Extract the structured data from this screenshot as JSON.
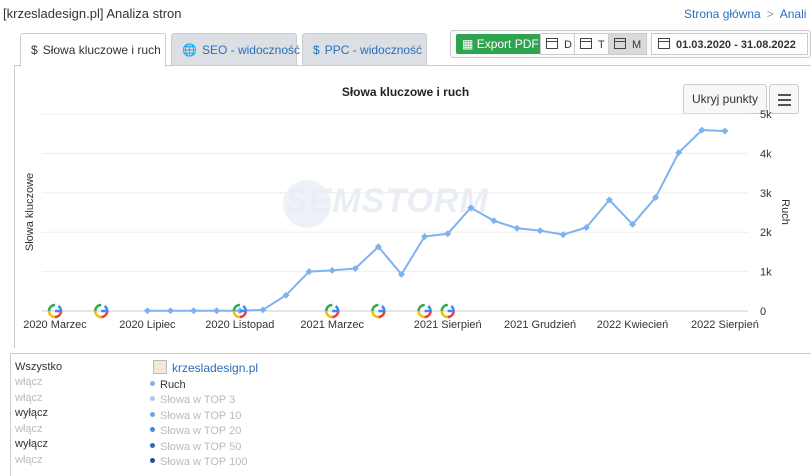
{
  "header": {
    "title": "[krzesladesign.pl] Analiza stron",
    "breadcrumb": [
      "Strona główna",
      "Anali"
    ]
  },
  "tabs": [
    {
      "label": "Słowa kluczowe i ruch",
      "icon": "dollar-icon",
      "active": true
    },
    {
      "label": "SEO - widoczność",
      "icon": "globe-icon",
      "active": false
    },
    {
      "label": "PPC - widoczność",
      "icon": "dollar-icon",
      "active": false
    }
  ],
  "toolbar": {
    "export_label": "Export PDF",
    "period_day": "D",
    "period_week": "T",
    "period_month": "M",
    "selected_period": "M",
    "date_range": "01.03.2020 - 31.08.2022"
  },
  "chart": {
    "title": "Słowa kluczowe i ruch",
    "hide_points_label": "Ukryj punkty",
    "ylabel_left": "Słowa kluczowe",
    "ylabel_right": "Ruch",
    "watermark": "SEMSTORM",
    "accent_color": "#7fb2f0"
  },
  "chart_data": {
    "type": "line",
    "x_labels": [
      "2020 Marzec",
      "2020 Lipiec",
      "2020 Listopad",
      "2021 Marzec",
      "2021 Sierpień",
      "2021 Grudzień",
      "2022 Kwiecień",
      "2022 Sierpień"
    ],
    "y_right_ticks": [
      "0",
      "1k",
      "2k",
      "3k",
      "4k",
      "5k"
    ],
    "ylim": [
      0,
      5000
    ],
    "series": [
      {
        "name": "Ruch",
        "x": [
          "2020-03",
          "2020-04",
          "2020-05",
          "2020-06",
          "2020-07",
          "2020-08",
          "2020-09",
          "2020-10",
          "2020-11",
          "2020-12",
          "2021-01",
          "2021-02",
          "2021-03",
          "2021-04",
          "2021-05",
          "2021-06",
          "2021-07",
          "2021-08",
          "2021-09",
          "2021-10",
          "2021-11",
          "2021-12",
          "2022-01",
          "2022-02",
          "2022-03",
          "2022-04",
          "2022-05",
          "2022-06",
          "2022-07",
          "2022-08"
        ],
        "values": [
          null,
          null,
          null,
          null,
          5,
          5,
          5,
          5,
          5,
          30,
          400,
          1000,
          1030,
          1080,
          1630,
          930,
          1890,
          1960,
          2620,
          2290,
          2100,
          2040,
          1940,
          2120,
          2820,
          2200,
          2880,
          4020,
          4590,
          4570
        ]
      }
    ],
    "google_update_markers": [
      "2020-03",
      "2020-05",
      "2020-11",
      "2021-03",
      "2021-05",
      "2021-07",
      "2021-08"
    ],
    "grid": true
  },
  "legend": {
    "all_label": "Wszystko",
    "toggles": [
      "włącz",
      "włącz",
      "wyłącz",
      "włącz",
      "wyłącz",
      "włącz"
    ],
    "site": "krzesladesign.pl",
    "series": [
      {
        "label": "Ruch",
        "color": "#7fb2f0",
        "enabled": true
      },
      {
        "label": "Słowa w TOP 3",
        "color": "#a9c9ee",
        "enabled": false
      },
      {
        "label": "Słowa w TOP 10",
        "color": "#6fa4e2",
        "enabled": false
      },
      {
        "label": "Słowa w TOP 20",
        "color": "#4a86d0",
        "enabled": false
      },
      {
        "label": "Słowa w TOP 50",
        "color": "#2f6bb8",
        "enabled": false
      },
      {
        "label": "Słowa w TOP 100",
        "color": "#1e4f92",
        "enabled": false
      }
    ]
  }
}
